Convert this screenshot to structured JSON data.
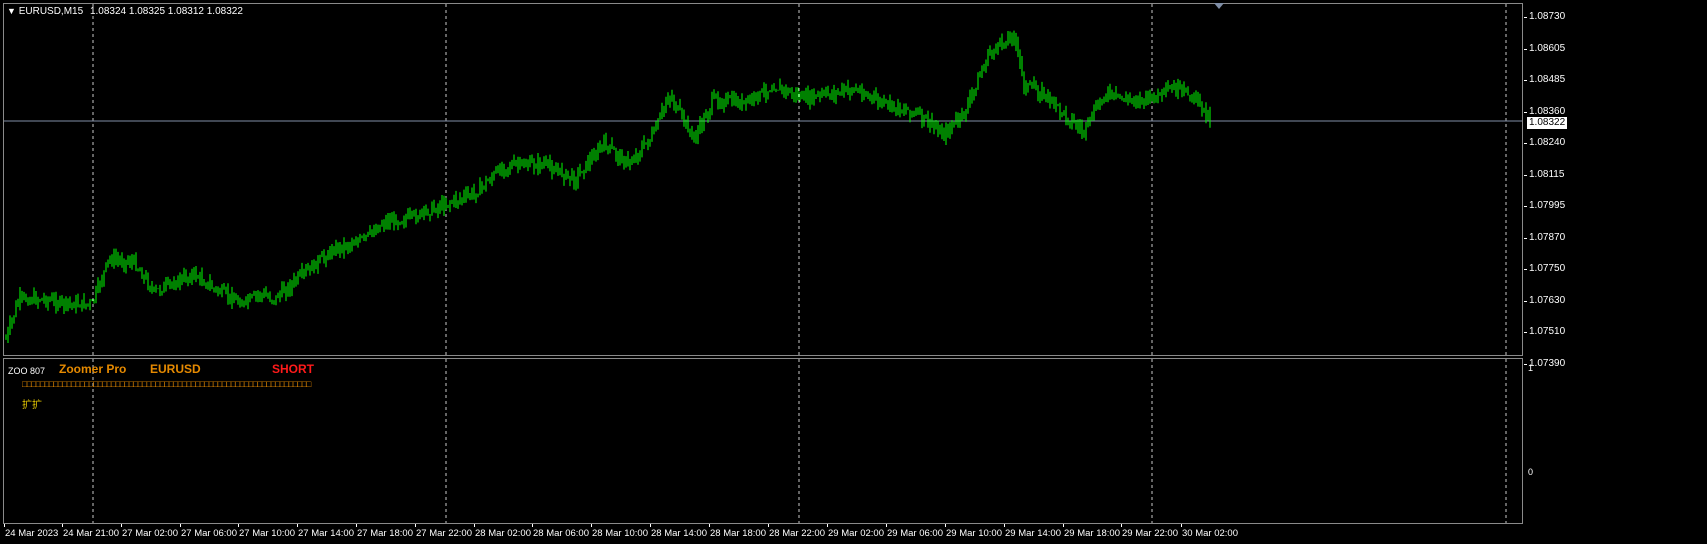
{
  "header": {
    "symbol_text": "EURUSD,M15",
    "ohlc_text": "1.08324 1.08325 1.08312 1.08322"
  },
  "price_scale": {
    "ticks": [
      "1.08730",
      "1.08605",
      "1.08485",
      "1.08360",
      "1.08240",
      "1.08115",
      "1.07995",
      "1.07870",
      "1.07750",
      "1.07630",
      "1.07510",
      "1.07390"
    ],
    "current_price": "1.08322"
  },
  "indicator": {
    "id_text": "ZOO 807",
    "name": "Zoomer Pro",
    "symbol": "EURUSD",
    "signal": "SHORT",
    "glyph_row": "□□□□□□□□□□□□□□□□□□□□□□□□□□□□□□□□□□□□□□□□□□□□□□□□□□□□□□□□□□□□□□□□□",
    "glyph_row2": "扩扩",
    "scale_top": "1",
    "scale_bottom": "0"
  },
  "time_axis": {
    "labels": [
      "24 Mar 2023",
      "24 Mar 21:00",
      "27 Mar 02:00",
      "27 Mar 06:00",
      "27 Mar 10:00",
      "27 Mar 14:00",
      "27 Mar 18:00",
      "27 Mar 22:00",
      "28 Mar 02:00",
      "28 Mar 06:00",
      "28 Mar 10:00",
      "28 Mar 14:00",
      "28 Mar 18:00",
      "28 Mar 22:00",
      "29 Mar 02:00",
      "29 Mar 06:00",
      "29 Mar 10:00",
      "29 Mar 14:00",
      "29 Mar 18:00",
      "29 Mar 22:00",
      "30 Mar 02:00"
    ]
  },
  "colors": {
    "candle": "#00ff00",
    "grid": "#c8c8c8",
    "price_line": "#7f8ea6",
    "indicator_name": "#e68a00",
    "indicator_signal": "#ff1a1a"
  }
}
